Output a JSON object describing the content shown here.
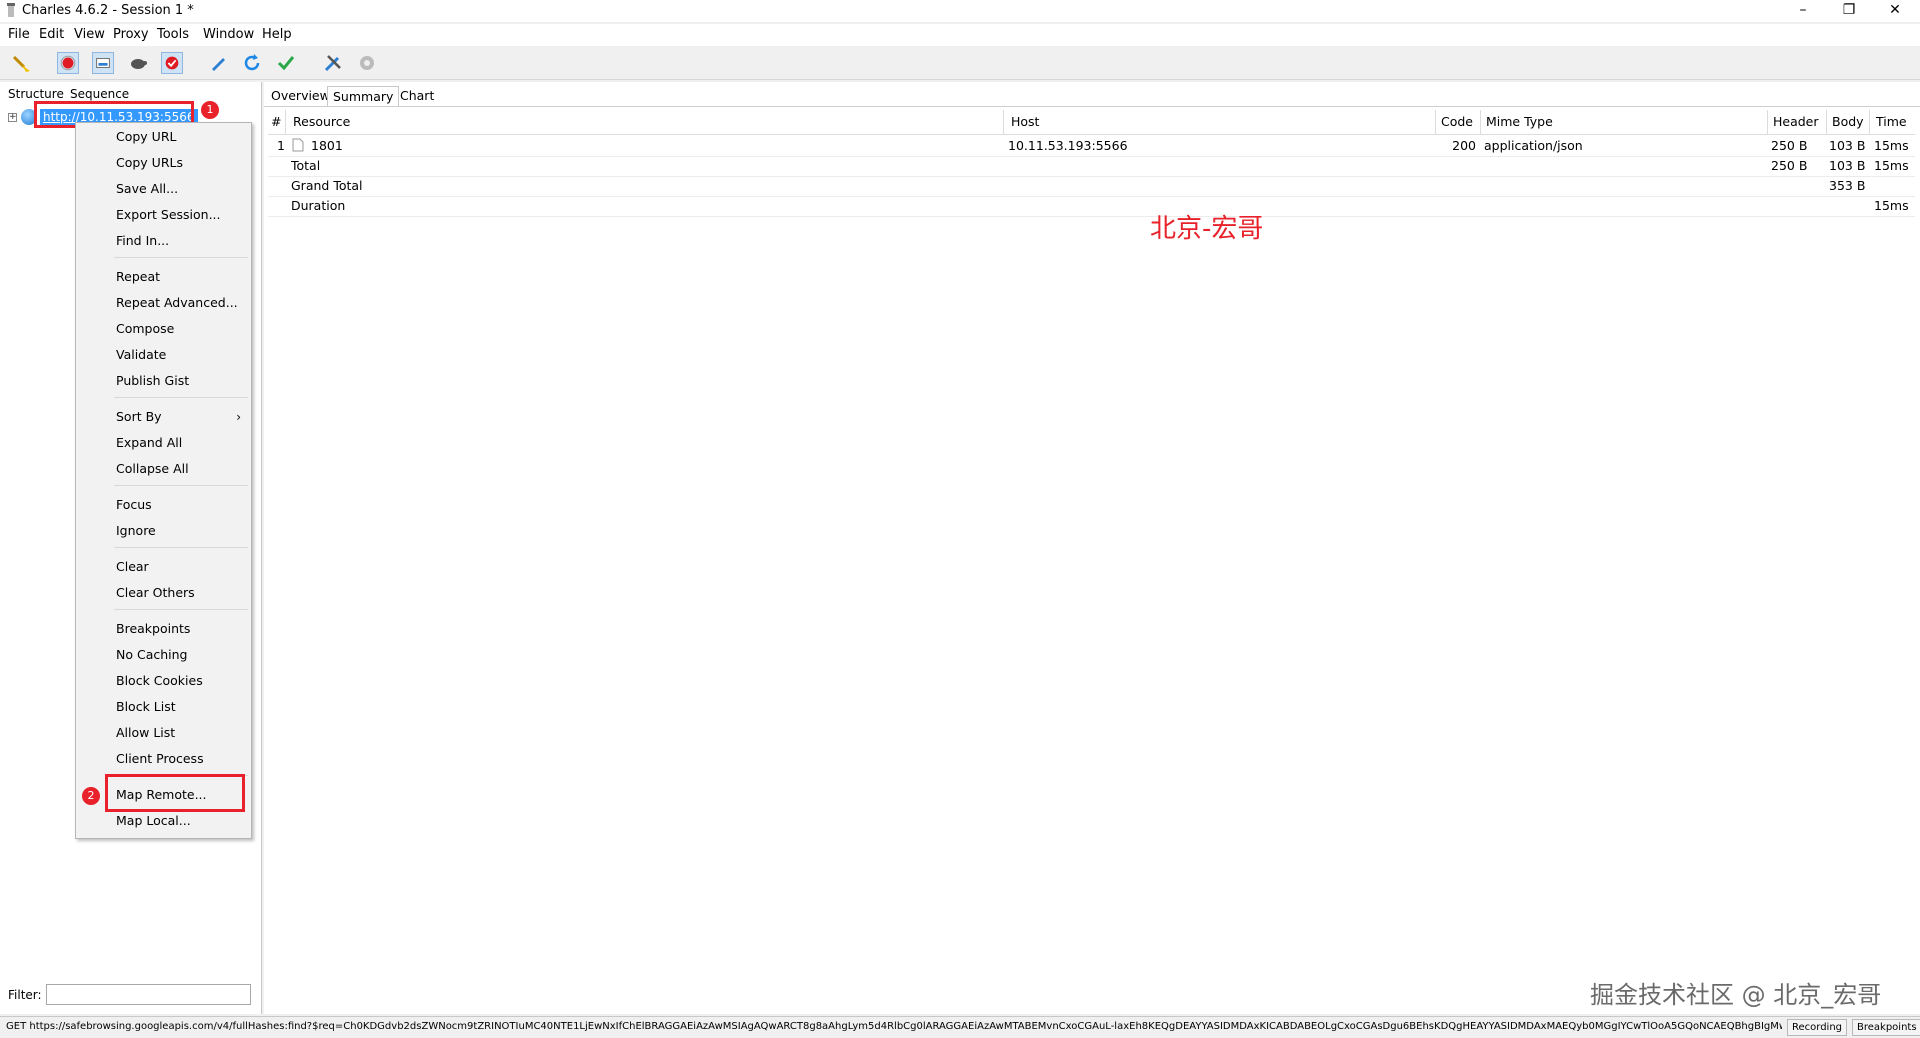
{
  "window": {
    "title": "Charles 4.6.2 - Session 1 *",
    "minimize": "–",
    "maximize": "❐",
    "close": "✕"
  },
  "menu": [
    "File",
    "Edit",
    "View",
    "Proxy",
    "Tools",
    "Window",
    "Help"
  ],
  "toolbar": {
    "icons": [
      "broom-icon",
      "record-icon",
      "throttle-icon",
      "turtle-icon",
      "breakpoint-icon",
      "pen-icon",
      "refresh-icon",
      "check-icon",
      "tools-icon",
      "settings-icon"
    ]
  },
  "left": {
    "tabs": [
      "Structure",
      "Sequence"
    ],
    "tree_expand": "+",
    "host": "http://10.11.53.193:5566",
    "badge1": "1",
    "filter_label": "Filter:",
    "filter_value": ""
  },
  "context_menu": {
    "items": [
      "Copy URL",
      "Copy URLs",
      "Save All...",
      "Export Session...",
      "Find In...",
      "Repeat",
      "Repeat Advanced...",
      "Compose",
      "Validate",
      "Publish Gist",
      "Sort By",
      "Expand All",
      "Collapse All",
      "Focus",
      "Ignore",
      "Clear",
      "Clear Others",
      "Breakpoints",
      "No Caching",
      "Block Cookies",
      "Block List",
      "Allow List",
      "Client Process",
      "Map Remote...",
      "Map Local..."
    ],
    "submenu_arrow": "›",
    "badge2": "2"
  },
  "right": {
    "tabs": [
      "Overview",
      "Summary",
      "Chart"
    ],
    "columns": [
      "#",
      "Resource",
      "Host",
      "Code",
      "Mime Type",
      "Header",
      "Body",
      "Time"
    ],
    "rows": [
      {
        "num": "1",
        "resource": "1801",
        "host": "10.11.53.193:5566",
        "code": "200",
        "mime": "application/json",
        "header": "250 B",
        "body": "103 B",
        "time": "15ms"
      },
      {
        "num": "",
        "resource": "Total",
        "host": "",
        "code": "",
        "mime": "",
        "header": "250 B",
        "body": "103 B",
        "time": "15ms"
      },
      {
        "num": "",
        "resource": "Grand Total",
        "host": "",
        "code": "",
        "mime": "",
        "header": "",
        "body": "353 B",
        "time": ""
      },
      {
        "num": "",
        "resource": "Duration",
        "host": "",
        "code": "",
        "mime": "",
        "header": "",
        "body": "",
        "time": "15ms"
      }
    ]
  },
  "watermarks": {
    "red": "北京-宏哥",
    "gray": "掘金技术社区 @ 北京_宏哥"
  },
  "status": {
    "text": "GET https://safebrowsing.googleapis.com/v4/fullHashes:find?$req=Ch0KDGdvb2dsZWNocm9tZRINOTIuMC40NTE1LjEwNxIfChElBRAGGAEiAzAwMSIAgAQwARCT8g8aAhgLym5d4RlbCg0lARAGGAEiAzAwMTABEMvnCxoCGAuL-laxEh8KEQgDEAYYASIDMDAxKICABDABEOLgCxoCGAsDgu6BEhsKDQgHEAYYASIDMDAxMAEQyb0MGgIYCwTlOoA5GQoNCAEQBhgBIgMwMDE...",
    "recording": "Recording",
    "breakpoints": "Breakpoints"
  }
}
